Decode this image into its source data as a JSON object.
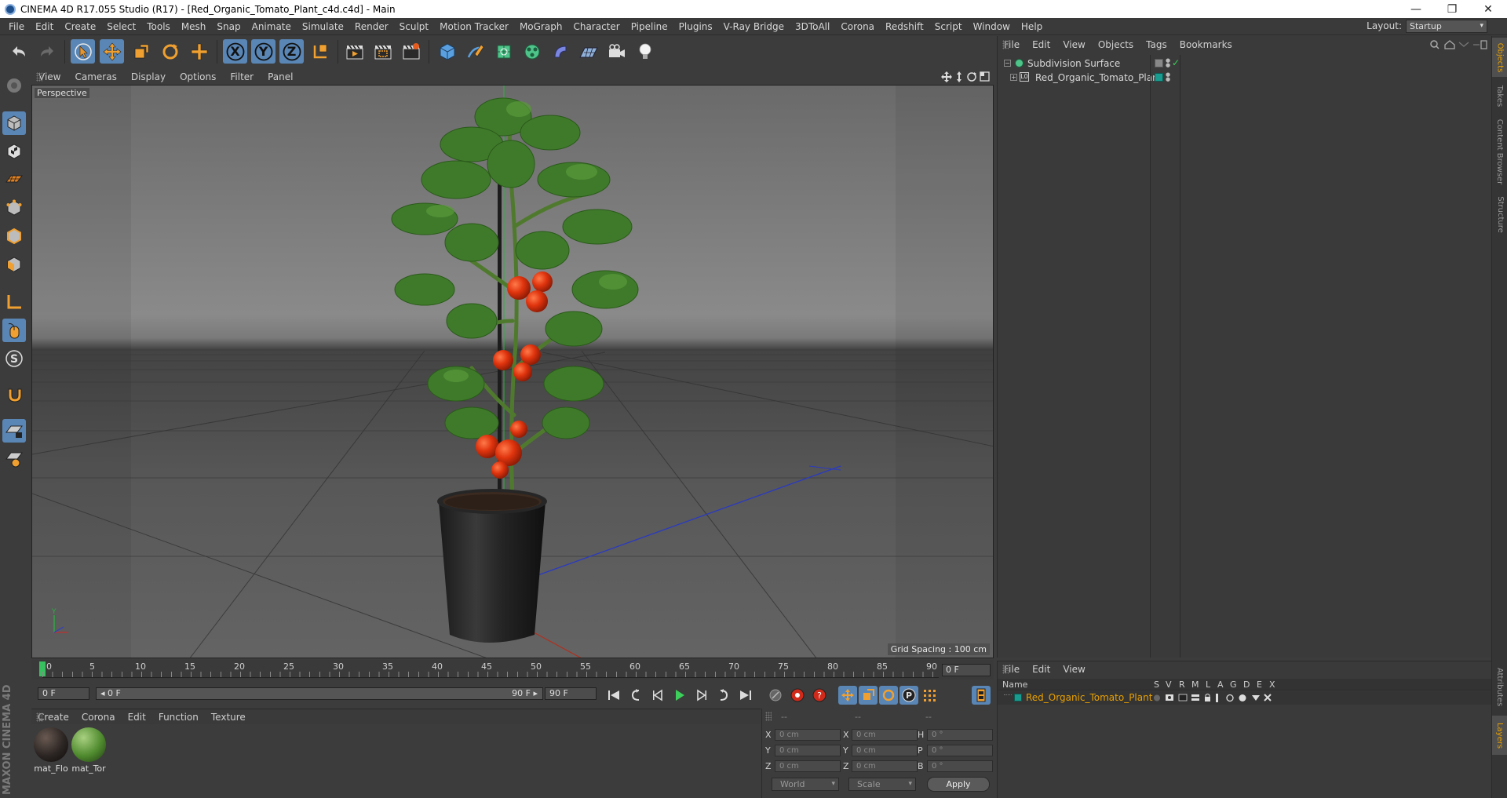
{
  "window": {
    "title": "CINEMA 4D R17.055 Studio (R17) - [Red_Organic_Tomato_Plant_c4d.c4d] - Main",
    "minimize": "—",
    "restore": "❐",
    "close": "✕"
  },
  "menubar": {
    "items": [
      "File",
      "Edit",
      "Create",
      "Select",
      "Tools",
      "Mesh",
      "Snap",
      "Animate",
      "Simulate",
      "Render",
      "Sculpt",
      "Motion Tracker",
      "MoGraph",
      "Character",
      "Pipeline",
      "Plugins",
      "V-Ray Bridge",
      "3DToAll",
      "Corona",
      "Redshift",
      "Script",
      "Window",
      "Help"
    ],
    "layout_label": "Layout:",
    "layout_value": "Startup"
  },
  "toolbar": {
    "axis_x": "X",
    "axis_y": "Y",
    "axis_z": "Z"
  },
  "viewport": {
    "menu": [
      "View",
      "Cameras",
      "Display",
      "Options",
      "Filter",
      "Panel"
    ],
    "label": "Perspective",
    "grid_spacing": "Grid Spacing : 100 cm"
  },
  "timeline": {
    "ticks": [
      "0",
      "5",
      "10",
      "15",
      "20",
      "25",
      "30",
      "35",
      "40",
      "45",
      "50",
      "55",
      "60",
      "65",
      "70",
      "75",
      "80",
      "85",
      "90"
    ],
    "current_frame": "0 F",
    "start_field": "0 F",
    "range_start": "◂ 0 F",
    "range_end": "90 F ▸",
    "end_field": "90 F"
  },
  "material_manager": {
    "menu": [
      "Create",
      "Corona",
      "Edit",
      "Function",
      "Texture"
    ],
    "materials": [
      {
        "label": "mat_Flo",
        "color": "#2b2523"
      },
      {
        "label": "mat_Tor",
        "color": "#4f8a2e"
      }
    ]
  },
  "coordinates": {
    "headers": [
      "--",
      "--",
      "--"
    ],
    "rows": [
      {
        "a": "X",
        "av": "0 cm",
        "b": "X",
        "bv": "0 cm",
        "c": "H",
        "cv": "0 °"
      },
      {
        "a": "Y",
        "av": "0 cm",
        "b": "Y",
        "bv": "0 cm",
        "c": "P",
        "cv": "0 °"
      },
      {
        "a": "Z",
        "av": "0 cm",
        "b": "Z",
        "bv": "0 cm",
        "c": "B",
        "cv": "0 °"
      }
    ],
    "space": "World",
    "mode": "Scale",
    "apply_label": "Apply"
  },
  "object_manager": {
    "menu": [
      "File",
      "Edit",
      "View",
      "Objects",
      "Tags",
      "Bookmarks"
    ],
    "objects": [
      {
        "name": "Subdivision Surface"
      },
      {
        "name": "Red_Organic_Tomato_Plant"
      }
    ]
  },
  "layer_manager": {
    "menu": [
      "File",
      "Edit",
      "View"
    ],
    "columns": [
      "Name",
      "S",
      "V",
      "R",
      "M",
      "L",
      "A",
      "G",
      "D",
      "E",
      "X"
    ],
    "layer_name": "Red_Organic_Tomato_Plant",
    "layer_color": "#1a9b8f"
  },
  "right_tabs": [
    "Objects",
    "Takes",
    "Content Browser",
    "Structure",
    "Attributes",
    "Layers"
  ],
  "colors": {
    "accent_blue": "#5a86b5",
    "highlight_orange": "#e8a000",
    "tomato_red": "#d8320e",
    "leaf_green": "#3f7a2a"
  },
  "branding": "MAXON CINEMA 4D"
}
